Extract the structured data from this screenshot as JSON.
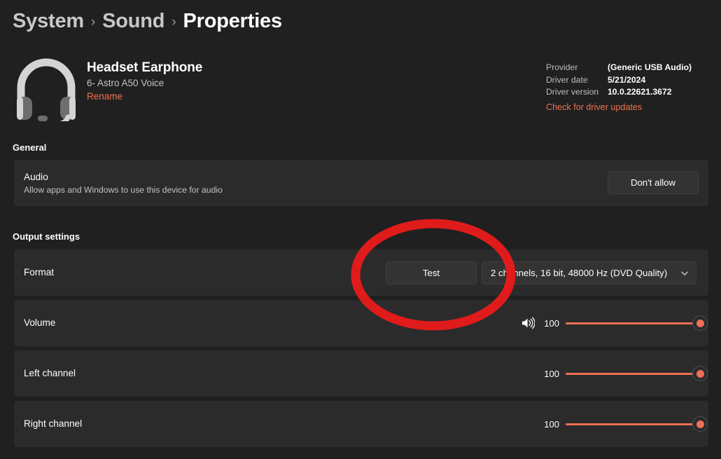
{
  "breadcrumb": {
    "items": [
      "System",
      "Sound",
      "Properties"
    ],
    "separator": "›"
  },
  "device": {
    "icon": "headset-icon",
    "name": "Headset Earphone",
    "subtitle": "6- Astro A50 Voice",
    "rename_label": "Rename"
  },
  "driver": {
    "provider_key": "Provider",
    "provider_value": "(Generic USB Audio)",
    "date_key": "Driver date",
    "date_value": "5/21/2024",
    "version_key": "Driver version",
    "version_value": "10.0.22621.3672",
    "update_link": "Check for driver updates"
  },
  "sections": {
    "general": "General",
    "output": "Output settings"
  },
  "audio": {
    "title": "Audio",
    "description": "Allow apps and Windows to use this device for audio",
    "button_label": "Don't allow"
  },
  "format": {
    "label": "Format",
    "test_label": "Test",
    "selected_option": "2 channels, 16 bit, 48000 Hz (DVD Quality)",
    "chevron": "chevron-down-icon"
  },
  "volume": {
    "label": "Volume",
    "icon": "speaker-icon",
    "value": "100",
    "percent": 100
  },
  "left_channel": {
    "label": "Left channel",
    "value": "100",
    "percent": 100
  },
  "right_channel": {
    "label": "Right channel",
    "value": "100",
    "percent": 100
  },
  "annotation": {
    "shape": "ellipse",
    "color": "#E01B1B",
    "target": "Test"
  },
  "colors": {
    "page_background": "#202020",
    "card_background": "#2B2B2B",
    "accent_link": "#F0714F",
    "slider_fill": "#EE6E52",
    "annotation_red": "#E01B1B"
  }
}
